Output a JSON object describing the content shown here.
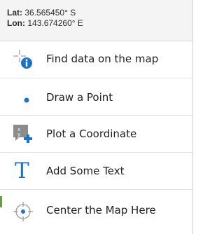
{
  "coordinates": {
    "lat_label": "Lat:",
    "lat_value": "36.565450° S",
    "lon_label": "Lon:",
    "lon_value": "143.674260° E"
  },
  "menu": {
    "items": [
      {
        "label": "Find data on the map",
        "icon": "find-data-icon"
      },
      {
        "label": "Draw a Point",
        "icon": "point-icon"
      },
      {
        "label": "Plot a Coordinate",
        "icon": "plot-coordinate-icon"
      },
      {
        "label": "Add Some Text",
        "icon": "text-icon"
      },
      {
        "label": "Center the Map Here",
        "icon": "crosshair-icon"
      }
    ]
  },
  "colors": {
    "accent_blue": "#1a73c9",
    "icon_gray": "#8a8a8a",
    "header_bg": "#f4f4f4"
  }
}
